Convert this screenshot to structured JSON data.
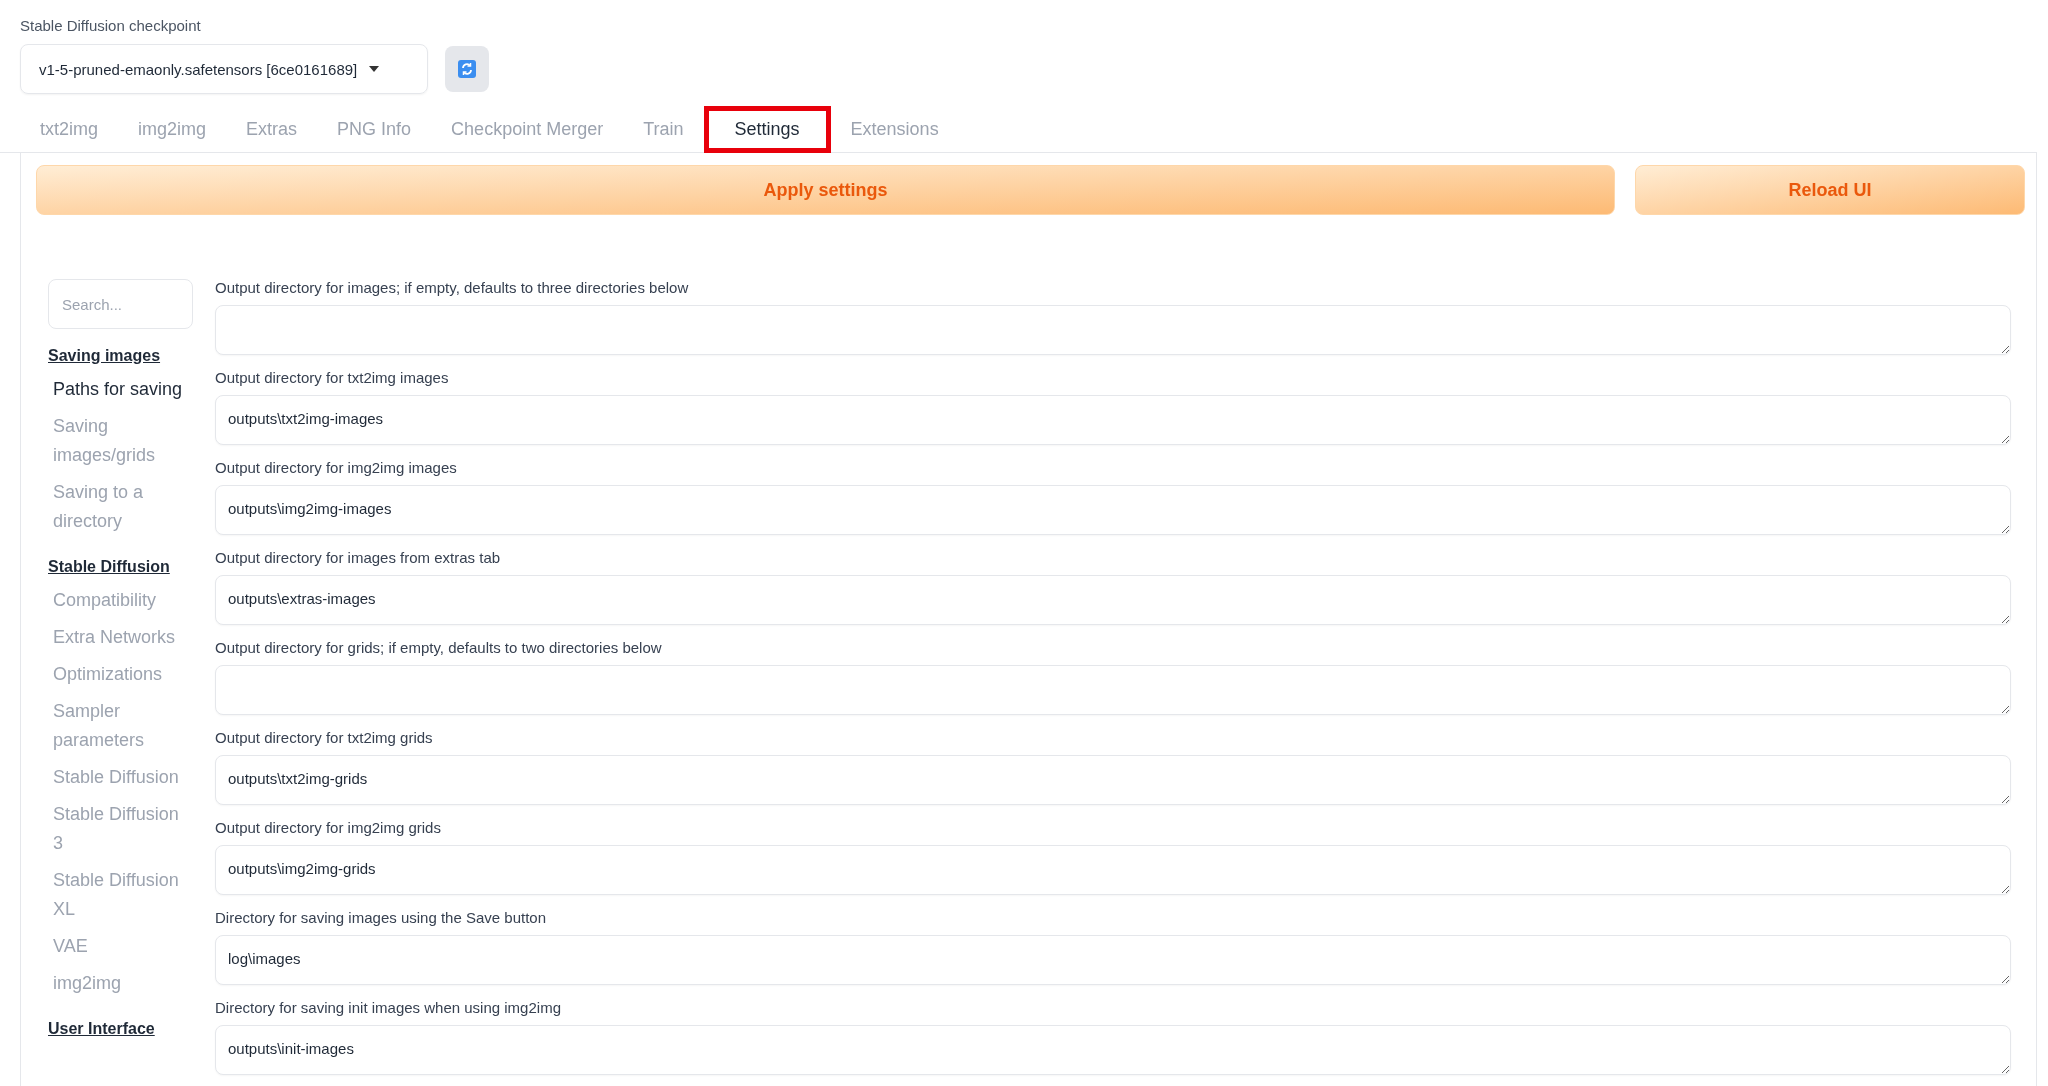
{
  "checkpoint": {
    "label": "Stable Diffusion checkpoint",
    "value": "v1-5-pruned-emaonly.safetensors [6ce0161689]"
  },
  "tabs": [
    {
      "label": "txt2img",
      "selected": false,
      "highlighted": false
    },
    {
      "label": "img2img",
      "selected": false,
      "highlighted": false
    },
    {
      "label": "Extras",
      "selected": false,
      "highlighted": false
    },
    {
      "label": "PNG Info",
      "selected": false,
      "highlighted": false
    },
    {
      "label": "Checkpoint Merger",
      "selected": false,
      "highlighted": false
    },
    {
      "label": "Train",
      "selected": false,
      "highlighted": false
    },
    {
      "label": "Settings",
      "selected": true,
      "highlighted": true
    },
    {
      "label": "Extensions",
      "selected": false,
      "highlighted": false
    }
  ],
  "buttons": {
    "apply": "Apply settings",
    "reload": "Reload UI"
  },
  "sidebar": {
    "search_placeholder": "Search...",
    "sections": [
      {
        "title": "Saving images",
        "items": [
          {
            "label": "Paths for saving",
            "selected": true
          },
          {
            "label": "Saving images/grids",
            "selected": false
          },
          {
            "label": "Saving to a directory",
            "selected": false
          }
        ]
      },
      {
        "title": "Stable Diffusion",
        "items": [
          {
            "label": "Compatibility",
            "selected": false
          },
          {
            "label": "Extra Networks",
            "selected": false
          },
          {
            "label": "Optimizations",
            "selected": false
          },
          {
            "label": "Sampler parameters",
            "selected": false
          },
          {
            "label": "Stable Diffusion",
            "selected": false
          },
          {
            "label": "Stable Diffusion 3",
            "selected": false
          },
          {
            "label": "Stable Diffusion XL",
            "selected": false
          },
          {
            "label": "VAE",
            "selected": false
          },
          {
            "label": "img2img",
            "selected": false
          }
        ]
      },
      {
        "title": "User Interface"
      }
    ]
  },
  "fields": [
    {
      "label": "Output directory for images; if empty, defaults to three directories below"
    },
    {
      "label": "Output directory for txt2img images",
      "value": "outputs\\txt2img-images"
    },
    {
      "label": "Output directory for img2img images",
      "value": "outputs\\img2img-images"
    },
    {
      "label": "Output directory for images from extras tab",
      "value": "outputs\\extras-images"
    },
    {
      "label": "Output directory for grids; if empty, defaults to two directories below"
    },
    {
      "label": "Output directory for txt2img grids",
      "value": "outputs\\txt2img-grids"
    },
    {
      "label": "Output directory for img2img grids",
      "value": "outputs\\img2img-grids"
    },
    {
      "label": "Directory for saving images using the Save button",
      "value": "log\\images"
    },
    {
      "label": "Directory for saving init images when using img2img",
      "value": "outputs\\init-images"
    }
  ]
}
